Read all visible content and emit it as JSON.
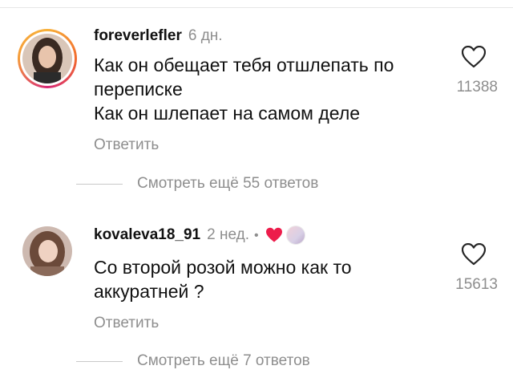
{
  "comments": [
    {
      "username": "foreverlefler",
      "time": "6 дн.",
      "lines": [
        "Как он обещает тебя отшлепать по",
        "переписке",
        "Как он шлепает на самом деле"
      ],
      "likes": "11388",
      "reply_label": "Ответить",
      "view_replies": "Смотреть ещё 55 ответов",
      "has_story_ring": true
    },
    {
      "username": "kovaleva18_91",
      "time": "2 нед.",
      "author_liked": true,
      "lines": [
        "Со второй розой можно как то",
        "аккуратней ?"
      ],
      "likes": "15613",
      "reply_label": "Ответить",
      "view_replies": "Смотреть ещё 7 ответов",
      "has_story_ring": false
    }
  ],
  "icons": {
    "like": "heart-outline-icon",
    "author_like": "heart-filled-icon"
  },
  "colors": {
    "author_like_heart": "#ed1c4b",
    "secondary_text": "#8e8e8e"
  }
}
